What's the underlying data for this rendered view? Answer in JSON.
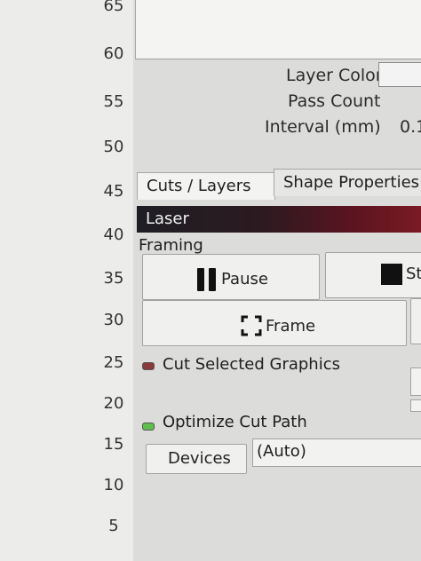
{
  "ruler": {
    "ticks": [
      "65",
      "60",
      "55",
      "50",
      "45",
      "40",
      "35",
      "30",
      "25",
      "20",
      "15",
      "10",
      "5"
    ]
  },
  "properties": {
    "layer_color_label": "Layer Color",
    "pass_count_label": "Pass Count",
    "interval_label": "Interval (mm)",
    "interval_value": "0.1"
  },
  "tabs": [
    {
      "label": "Cuts / Layers",
      "active": true
    },
    {
      "label": "Shape Properties",
      "active": false
    }
  ],
  "laser": {
    "title": "Laser",
    "framing_label": "Framing",
    "pause_label": "Pause",
    "stop_label": "St",
    "frame_label": "Frame",
    "cut_selected_label": "Cut Selected Graphics",
    "cut_selected_on": false,
    "optimize_label": "Optimize Cut Path",
    "optimize_on": true,
    "devices_label": "Devices",
    "device_value": "(Auto)"
  },
  "colors": {
    "led_off": "#8a3a3a",
    "led_on": "#5cc04a",
    "laser_header": "#7a1a24"
  }
}
